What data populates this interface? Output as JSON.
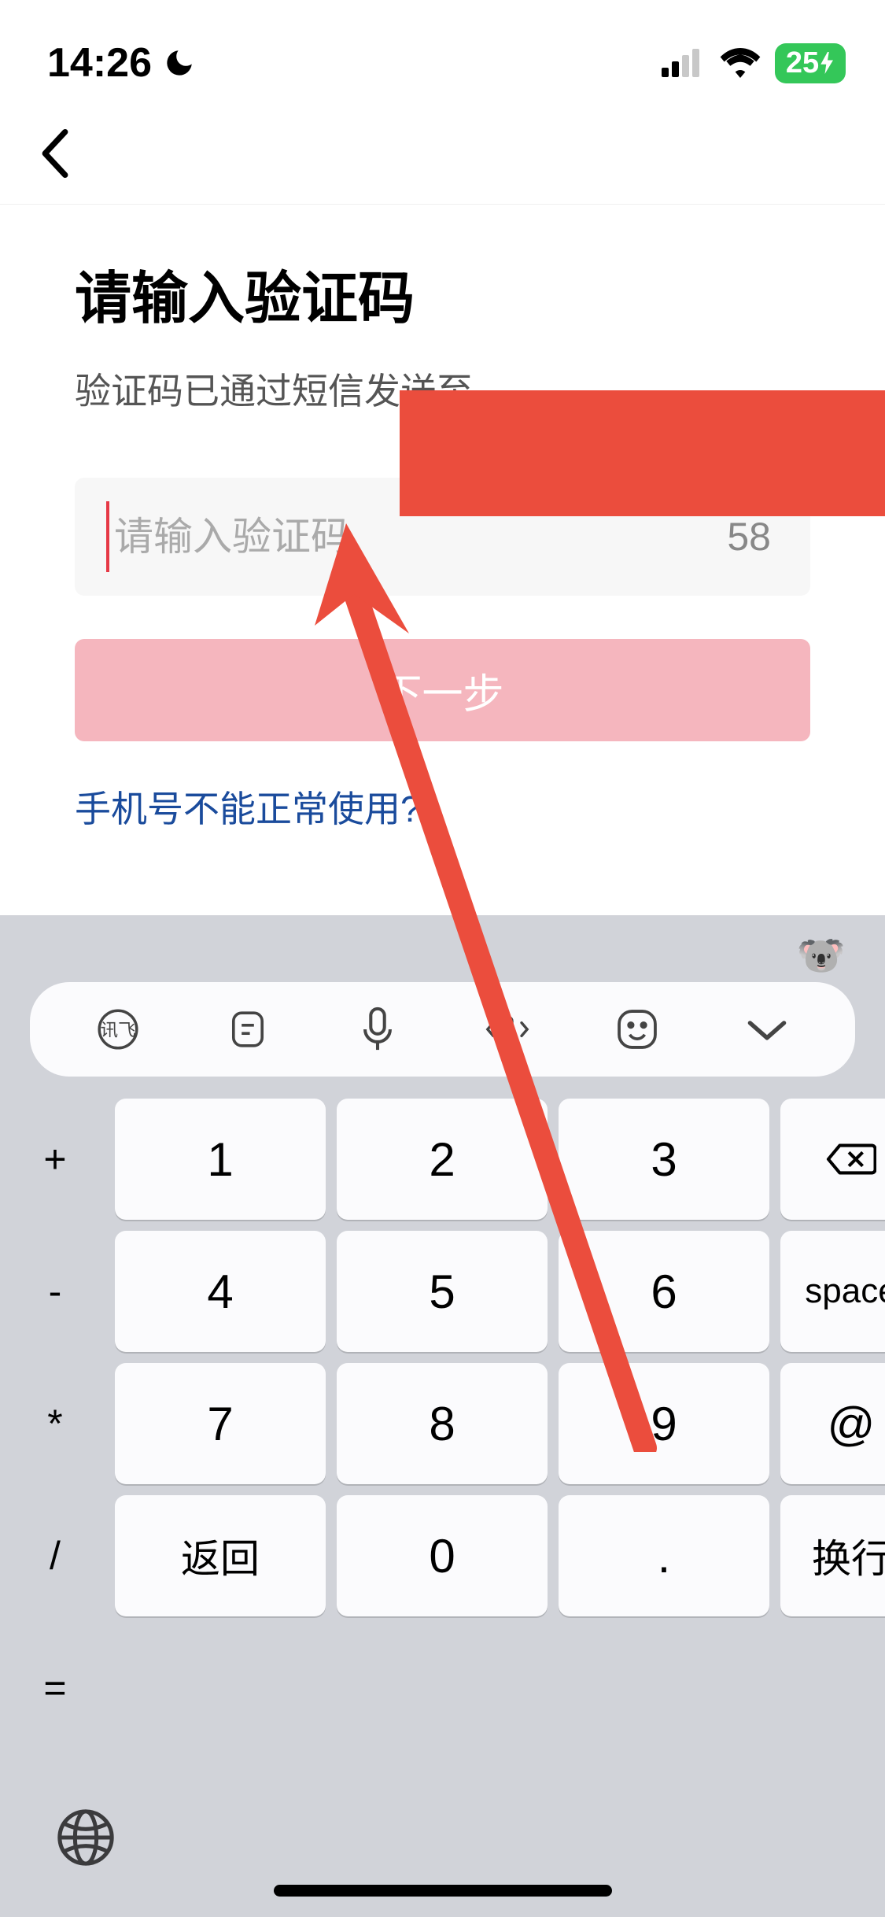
{
  "status": {
    "time": "14:26",
    "battery": "25",
    "battery_charging": true
  },
  "page": {
    "title": "请输入验证码",
    "subtitle": "验证码已通过短信发送至",
    "input_placeholder": "请输入验证码",
    "countdown": "58",
    "next_button": "下一步",
    "help_link": "手机号不能正常使用?"
  },
  "keyboard": {
    "toolbar_icons": [
      "xunfei",
      "clipboard",
      "mic",
      "cursor-move",
      "emoji",
      "collapse"
    ],
    "rows": [
      [
        "+",
        "1",
        "2",
        "3",
        "backspace"
      ],
      [
        "-",
        "4",
        "5",
        "6",
        "space"
      ],
      [
        "*",
        "7",
        "8",
        "9",
        "@"
      ],
      [
        "/",
        "返回",
        "0",
        ".",
        "换行"
      ],
      [
        "="
      ]
    ],
    "backspace_label": "⌫",
    "space_label": "space",
    "at_label": "@",
    "return_label": "返回",
    "newline_label": "换行"
  },
  "annotation": {
    "type": "arrow",
    "color": "#eb4d3d"
  }
}
